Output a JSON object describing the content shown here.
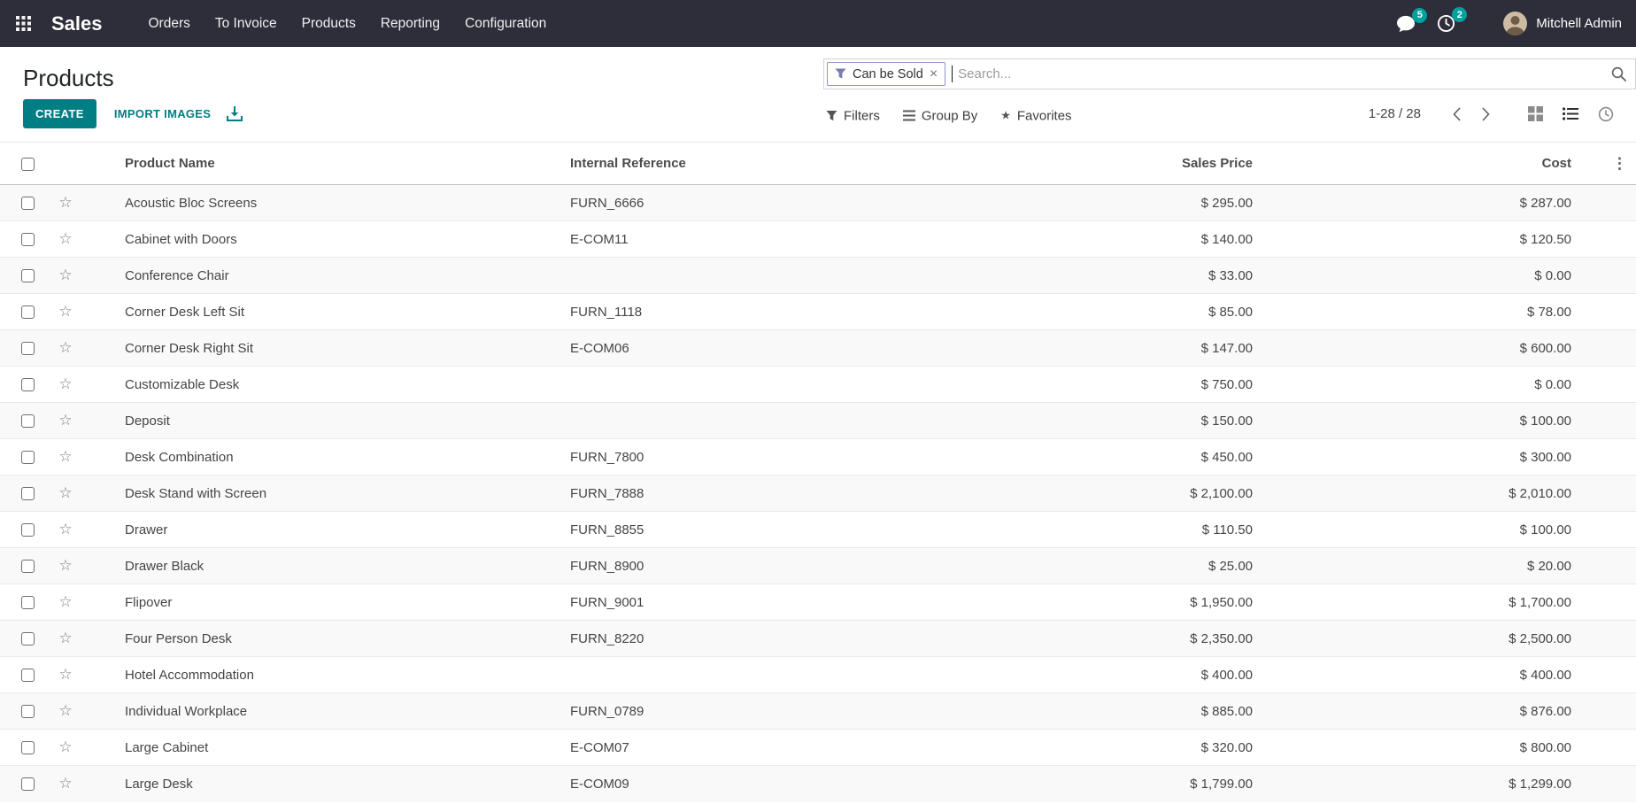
{
  "nav": {
    "app_name": "Sales",
    "menu_items": [
      "Orders",
      "To Invoice",
      "Products",
      "Reporting",
      "Configuration"
    ],
    "messages_badge": "5",
    "activities_badge": "2",
    "user_name": "Mitchell Admin"
  },
  "header": {
    "title": "Products",
    "search": {
      "facet_label": "Can be Sold",
      "placeholder": "Search..."
    }
  },
  "controls": {
    "create_label": "CREATE",
    "import_label": "IMPORT IMAGES",
    "filters_label": "Filters",
    "group_by_label": "Group By",
    "favorites_label": "Favorites",
    "pager_text": "1-28 / 28"
  },
  "table": {
    "columns": [
      "Product Name",
      "Internal Reference",
      "Sales Price",
      "Cost"
    ],
    "rows": [
      {
        "name": "Acoustic Bloc Screens",
        "ref": "FURN_6666",
        "price": "$ 295.00",
        "cost": "$ 287.00"
      },
      {
        "name": "Cabinet with Doors",
        "ref": "E-COM11",
        "price": "$ 140.00",
        "cost": "$ 120.50"
      },
      {
        "name": "Conference Chair",
        "ref": "",
        "price": "$ 33.00",
        "cost": "$ 0.00"
      },
      {
        "name": "Corner Desk Left Sit",
        "ref": "FURN_1118",
        "price": "$ 85.00",
        "cost": "$ 78.00"
      },
      {
        "name": "Corner Desk Right Sit",
        "ref": "E-COM06",
        "price": "$ 147.00",
        "cost": "$ 600.00"
      },
      {
        "name": "Customizable Desk",
        "ref": "",
        "price": "$ 750.00",
        "cost": "$ 0.00"
      },
      {
        "name": "Deposit",
        "ref": "",
        "price": "$ 150.00",
        "cost": "$ 100.00"
      },
      {
        "name": "Desk Combination",
        "ref": "FURN_7800",
        "price": "$ 450.00",
        "cost": "$ 300.00"
      },
      {
        "name": "Desk Stand with Screen",
        "ref": "FURN_7888",
        "price": "$ 2,100.00",
        "cost": "$ 2,010.00"
      },
      {
        "name": "Drawer",
        "ref": "FURN_8855",
        "price": "$ 110.50",
        "cost": "$ 100.00"
      },
      {
        "name": "Drawer Black",
        "ref": "FURN_8900",
        "price": "$ 25.00",
        "cost": "$ 20.00"
      },
      {
        "name": "Flipover",
        "ref": "FURN_9001",
        "price": "$ 1,950.00",
        "cost": "$ 1,700.00"
      },
      {
        "name": "Four Person Desk",
        "ref": "FURN_8220",
        "price": "$ 2,350.00",
        "cost": "$ 2,500.00"
      },
      {
        "name": "Hotel Accommodation",
        "ref": "",
        "price": "$ 400.00",
        "cost": "$ 400.00"
      },
      {
        "name": "Individual Workplace",
        "ref": "FURN_0789",
        "price": "$ 885.00",
        "cost": "$ 876.00"
      },
      {
        "name": "Large Cabinet",
        "ref": "E-COM07",
        "price": "$ 320.00",
        "cost": "$ 800.00"
      },
      {
        "name": "Large Desk",
        "ref": "E-COM09",
        "price": "$ 1,799.00",
        "cost": "$ 1,299.00"
      }
    ]
  },
  "icons": {
    "apps_menu": "grid-3x3",
    "messages": "chat-bubble",
    "activities": "clock",
    "facet_filter": "funnel",
    "facet_remove": "×",
    "search": "magnifier",
    "filters": "funnel",
    "group_by": "list-bars",
    "favorites": "★",
    "export": "download-tray",
    "pager_previous": "chevron-left",
    "pager_next": "chevron-right",
    "view_kanban": "grid-2x2",
    "view_list": "list-lines",
    "view_activity": "clock",
    "row_star": "☆",
    "optional_columns": "⋮"
  },
  "colors": {
    "navbar_bg": "#2e2d3a",
    "accent_teal": "#017e84",
    "badge_teal": "#00a09d",
    "facet_border": "#9292c8",
    "facet_funnel": "#7c7bad",
    "row_stripe": "#f9f9f9"
  }
}
